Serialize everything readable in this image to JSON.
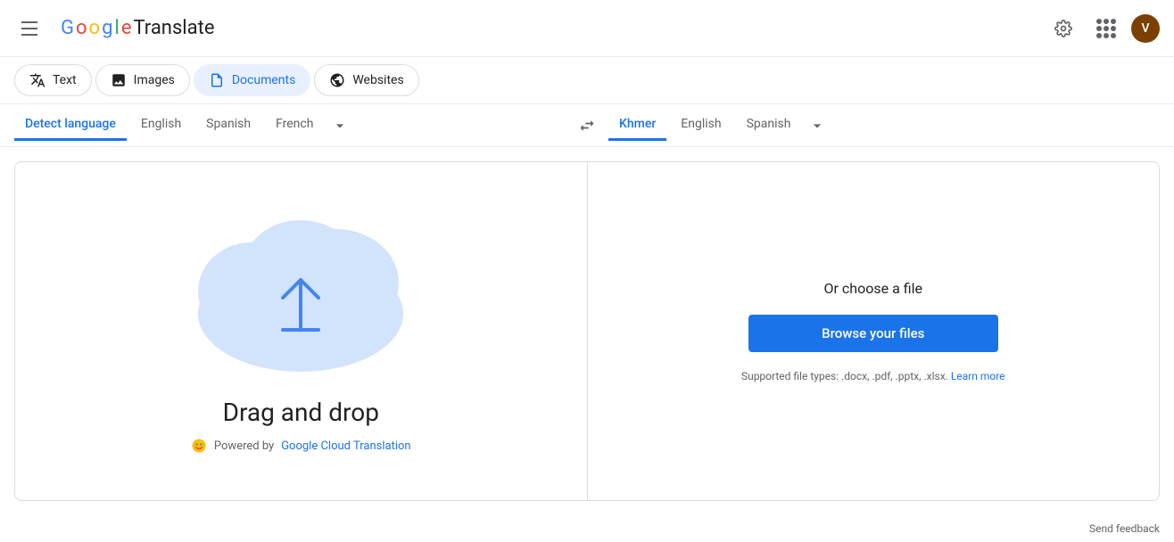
{
  "header": {
    "app_name": "Translate",
    "logo_letters": "Google",
    "avatar_letter": "V",
    "avatar_color": "#7b3f00"
  },
  "tabs": [
    {
      "id": "text",
      "label": "Text",
      "icon": "translate-icon",
      "active": false
    },
    {
      "id": "images",
      "label": "Images",
      "icon": "image-icon",
      "active": false
    },
    {
      "id": "documents",
      "label": "Documents",
      "icon": "document-icon",
      "active": true
    },
    {
      "id": "websites",
      "label": "Websites",
      "icon": "globe-icon",
      "active": false
    }
  ],
  "source_languages": [
    {
      "id": "detect",
      "label": "Detect language",
      "active": true
    },
    {
      "id": "english",
      "label": "English",
      "active": false
    },
    {
      "id": "spanish",
      "label": "Spanish",
      "active": false
    },
    {
      "id": "french",
      "label": "French",
      "active": false
    }
  ],
  "target_languages": [
    {
      "id": "khmer",
      "label": "Khmer",
      "active": true
    },
    {
      "id": "english",
      "label": "English",
      "active": false
    },
    {
      "id": "spanish",
      "label": "Spanish",
      "active": false
    }
  ],
  "main": {
    "drag_drop_label": "Drag and drop",
    "choose_file_label": "Or choose a file",
    "browse_btn_label": "Browse your files",
    "supported_text": "Supported file types: .docx, .pdf, .pptx, .xlsx.",
    "learn_more_label": "Learn more"
  },
  "footer": {
    "powered_by_prefix": "Powered by",
    "powered_by_link": "Google Cloud Translation"
  },
  "send_feedback": "Send feedback"
}
